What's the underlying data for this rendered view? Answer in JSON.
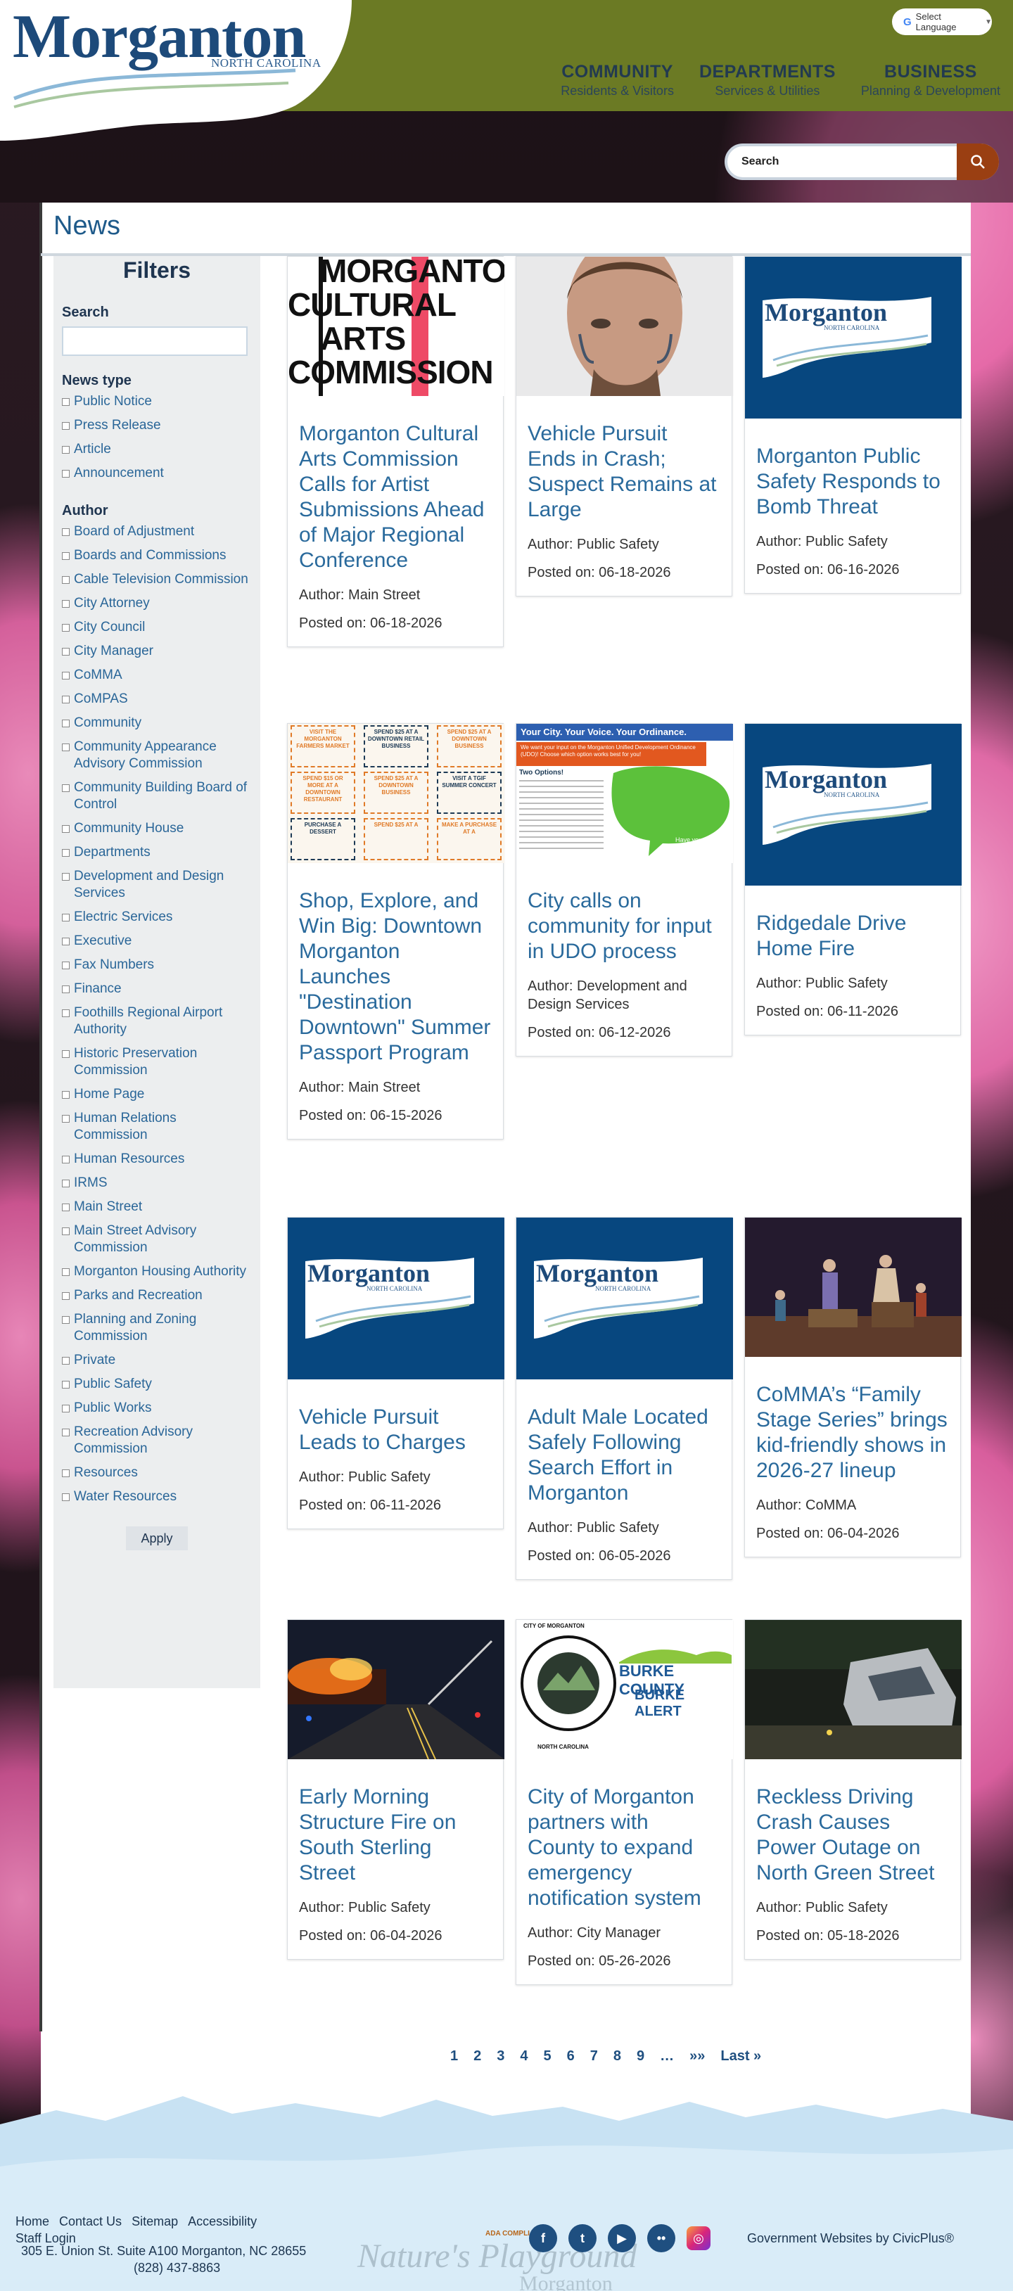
{
  "header": {
    "logo_title": "Morganton",
    "logo_subtitle": "NORTH CAROLINA",
    "language_label": "Select Language",
    "nav": [
      {
        "title": "COMMUNITY",
        "subtitle": "Residents & Visitors"
      },
      {
        "title": "DEPARTMENTS",
        "subtitle": "Services & Utilities"
      },
      {
        "title": "BUSINESS",
        "subtitle": "Planning & Development"
      }
    ],
    "search_placeholder": "Search"
  },
  "page": {
    "title": "News"
  },
  "filters": {
    "title": "Filters",
    "search_label": "Search",
    "news_type_label": "News type",
    "news_types": [
      "Public Notice",
      "Press Release",
      "Article",
      "Announcement"
    ],
    "author_label": "Author",
    "authors": [
      "Board of Adjustment",
      "Boards and Commissions",
      "Cable Television Commission",
      "City Attorney",
      "City Council",
      "City Manager",
      "CoMMA",
      "CoMPAS",
      "Community",
      "Community Appearance Advisory Commission",
      "Community Building Board of Control",
      "Community House",
      "Departments",
      "Development and Design Services",
      "Electric Services",
      "Executive",
      "Fax Numbers",
      "Finance",
      "Foothills Regional Airport Authority",
      "Historic Preservation Commission",
      "Home Page",
      "Human Relations Commission",
      "Human Resources",
      "IRMS",
      "Main Street",
      "Main Street Advisory Commission",
      "Morganton Housing Authority",
      "Parks and Recreation",
      "Planning and Zoning Commission",
      "Private",
      "Public Safety",
      "Public Works",
      "Recreation Advisory Commission",
      "Resources",
      "Water Resources"
    ],
    "apply_label": "Apply"
  },
  "cards": [
    {
      "title": "Morganton Cultural Arts Commission Calls for Artist Submissions Ahead of Major Regional Conference",
      "author": "Author: Main Street",
      "date": "Posted on: 06-18-2026",
      "image": "arts-commission-logo",
      "image_text": [
        "MORGANTON",
        "CULTURAL",
        "ARTS",
        "COMMISSION"
      ]
    },
    {
      "title": "Vehicle Pursuit Ends in Crash; Suspect Remains at Large",
      "author": "Author: Public Safety",
      "date": "Posted on: 06-18-2026",
      "image": "suspect-photo"
    },
    {
      "title": "Morganton Public Safety Responds to Bomb Threat",
      "author": "Author: Public Safety",
      "date": "Posted on: 06-16-2026",
      "image": "morganton-logo"
    },
    {
      "title": "Shop, Explore, and Win Big: Downtown Morganton Launches \"Destination Downtown\" Summer Passport Program",
      "author": "Author: Main Street",
      "date": "Posted on: 06-15-2026",
      "image": "passport-card",
      "image_text": [
        "VISIT THE MORGANTON FARMERS MARKET",
        "SPEND $25 AT A DOWNTOWN RETAIL BUSINESS",
        "SPEND $25 AT A DOWNTOWN BUSINESS",
        "SPEND $15 OR MORE AT A DOWNTOWN RESTAURANT",
        "SPEND $25 AT A DOWNTOWN BUSINESS",
        "VISIT A TGIF SUMMER CONCERT",
        "PURCHASE A DESSERT",
        "SPEND $25 AT A",
        "MAKE A PURCHASE AT A"
      ]
    },
    {
      "title": "City calls on community for input in UDO process",
      "author": "Author: Development and Design Services",
      "date": "Posted on: 06-12-2026",
      "image": "udo-flyer",
      "image_text": [
        "Your City. Your Voice. Your Ordinance.",
        "We want your input on the Morganton Unified Development Ordinance (UDO)! Choose which option works best for you!",
        "Two Options!",
        "Have your say!"
      ]
    },
    {
      "title": "Ridgedale Drive Home Fire",
      "author": "Author: Public Safety",
      "date": "Posted on: 06-11-2026",
      "image": "morganton-logo"
    },
    {
      "title": "Vehicle Pursuit Leads to Charges",
      "author": "Author: Public Safety",
      "date": "Posted on: 06-11-2026",
      "image": "morganton-logo"
    },
    {
      "title": "Adult Male Located Safely Following Search Effort in Morganton",
      "author": "Author: Public Safety",
      "date": "Posted on: 06-05-2026",
      "image": "morganton-logo"
    },
    {
      "title": "CoMMA’s “Family Stage Series” brings kid-friendly shows in 2026-27 lineup",
      "author": "Author: CoMMA",
      "date": "Posted on: 06-04-2026",
      "image": "stage-photo"
    },
    {
      "title": "Early Morning Structure Fire on South Sterling Street",
      "author": "Author: Public Safety",
      "date": "Posted on: 06-04-2026",
      "image": "fire-photo"
    },
    {
      "title": "City of Morganton partners with County to expand emergency notification system",
      "author": "Author: City Manager",
      "date": "Posted on: 05-26-2026",
      "image": "burke-alert",
      "image_text": [
        "CITY OF MORGANTON",
        "NORTH CAROLINA",
        "BURKE COUNTY",
        "BURKE ALERT"
      ]
    },
    {
      "title": "Reckless Driving Crash Causes Power Outage on North Green Street",
      "author": "Author: Public Safety",
      "date": "Posted on: 05-18-2026",
      "image": "crash-photo"
    }
  ],
  "pagination": [
    "1",
    "2",
    "3",
    "4",
    "5",
    "6",
    "7",
    "8",
    "9",
    "…",
    "»»",
    "Last »"
  ],
  "footer": {
    "links": [
      "Home",
      "Contact Us",
      "Sitemap",
      "Accessibility"
    ],
    "staff_login": "Staff Login",
    "address": "305 E. Union St. Suite A100 Morganton, NC 28655",
    "phone": "(828) 437-8863",
    "badge": "ADA COMPLIANT",
    "brand_watermark": "Nature's Playground",
    "brand_watermark_sub": "Morganton",
    "socials": [
      "facebook-icon",
      "twitter-icon",
      "youtube-icon",
      "flickr-icon",
      "instagram-icon"
    ],
    "civic": "Government Websites by CivicPlus®"
  },
  "colors": {
    "header_bg": "#6b7a24",
    "brand_blue": "#1d4a7a",
    "link_blue": "#2a6a9c",
    "search_button": "#9a3f12"
  }
}
